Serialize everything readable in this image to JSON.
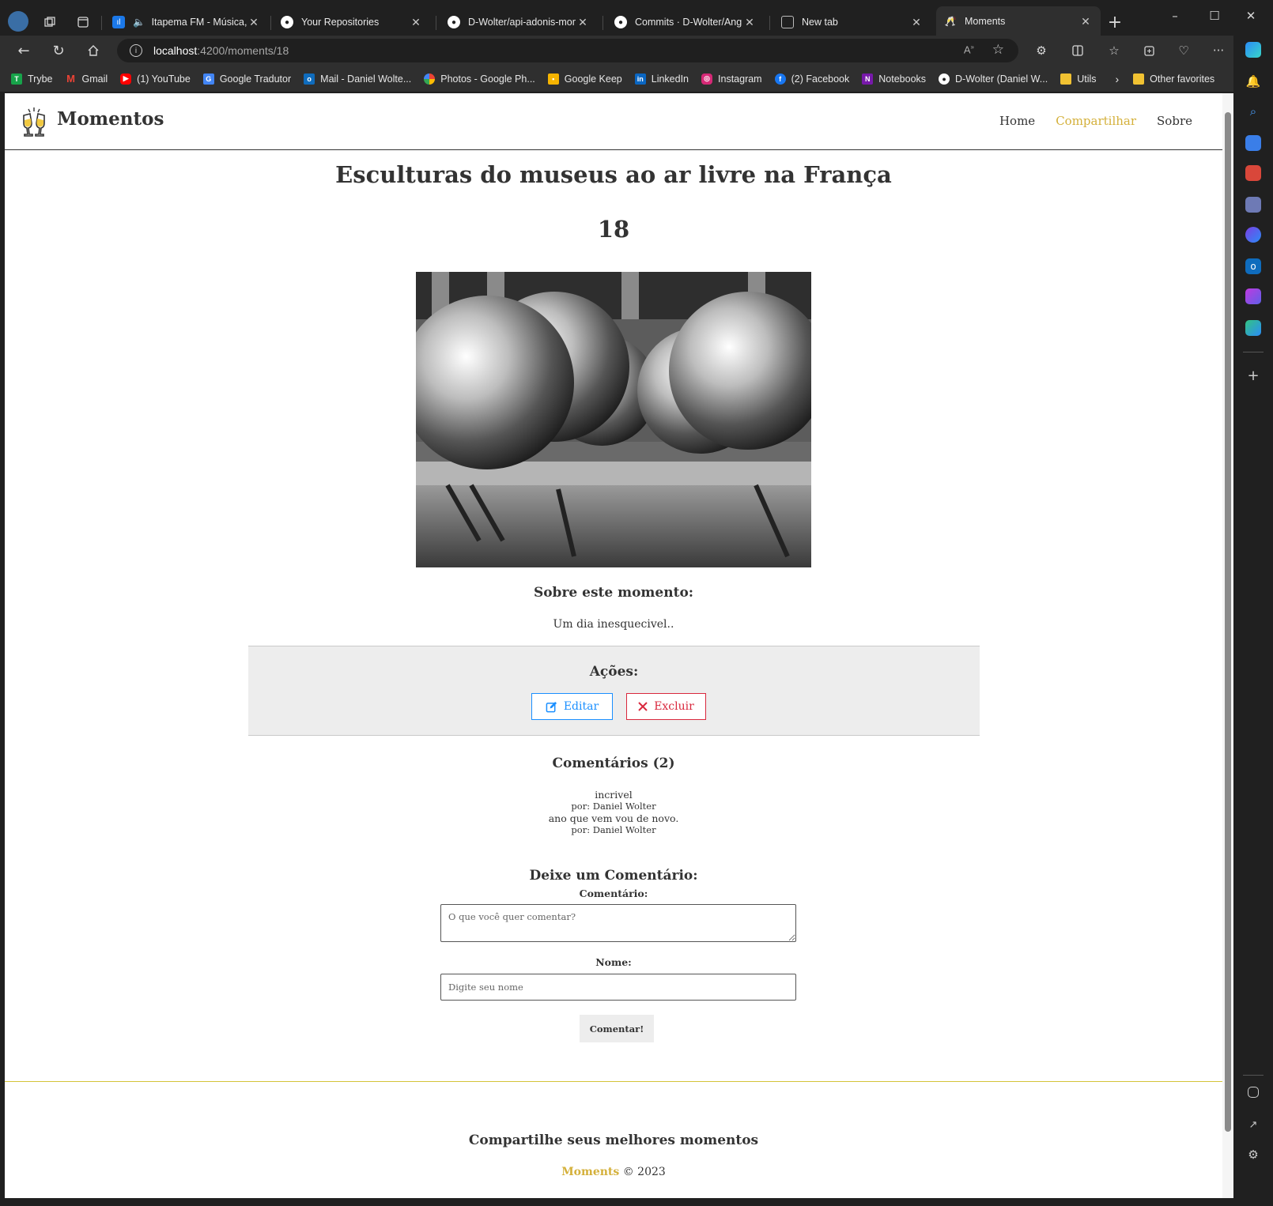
{
  "browser": {
    "tabs": [
      {
        "label": "Itapema FM - Música, ",
        "icon": "radio-icon",
        "color": "#1b78e8"
      },
      {
        "label": "Your Repositories",
        "icon": "github-icon",
        "color": "#ffffff"
      },
      {
        "label": "D-Wolter/api-adonis-mome",
        "icon": "github-icon",
        "color": "#ffffff"
      },
      {
        "label": "Commits · D-Wolter/Angul",
        "icon": "github-icon",
        "color": "#ffffff"
      },
      {
        "label": "New tab",
        "icon": "newtab-icon",
        "color": "#aaaaaa"
      },
      {
        "label": "Moments",
        "icon": "cheers-icon",
        "color": "#e0b84a"
      }
    ],
    "address": {
      "host": "localhost",
      "path": ":4200/moments/18"
    },
    "bookmarks": [
      {
        "label": "Trybe",
        "icon": "trybe-icon",
        "color": "#17a34a"
      },
      {
        "label": "Gmail",
        "icon": "gmail-icon",
        "color": "#ea4335"
      },
      {
        "label": "(1) YouTube",
        "icon": "youtube-icon",
        "color": "#ff0000"
      },
      {
        "label": "Google Tradutor",
        "icon": "translate-icon",
        "color": "#4285f4"
      },
      {
        "label": "Mail - Daniel Wolte...",
        "icon": "outlook-icon",
        "color": "#0f6cbd"
      },
      {
        "label": "Photos - Google Ph...",
        "icon": "photos-icon",
        "color": "#fbbc04"
      },
      {
        "label": "Google Keep",
        "icon": "keep-icon",
        "color": "#f6b400"
      },
      {
        "label": "LinkedIn",
        "icon": "linkedin-icon",
        "color": "#0a66c2"
      },
      {
        "label": "Instagram",
        "icon": "instagram-icon",
        "color": "#d62976"
      },
      {
        "label": "(2) Facebook",
        "icon": "facebook-icon",
        "color": "#1877f2"
      },
      {
        "label": "Notebooks",
        "icon": "onenote-icon",
        "color": "#7719aa"
      },
      {
        "label": "D-Wolter (Daniel W...",
        "icon": "github-icon",
        "color": "#ffffff"
      },
      {
        "label": "Utils",
        "icon": "folder-icon",
        "color": "#f1c232"
      }
    ],
    "other_favorites": "Other favorites"
  },
  "site": {
    "brand": "Momentos",
    "nav": {
      "home": "Home",
      "share": "Compartilhar",
      "about": "Sobre"
    },
    "accent_color": "#d4b03a"
  },
  "moment": {
    "title": "Esculturas do museus ao ar livre na França",
    "id": "18",
    "image_alt": "Esculturas do museus ao ar livre na França",
    "about_heading": "Sobre este momento:",
    "about_text": "Um dia inesquecivel.."
  },
  "actions": {
    "heading": "Ações:",
    "edit": "Editar",
    "delete": "Excluir"
  },
  "comments": {
    "heading": "Comentários (2)",
    "items": [
      {
        "text": "incrivel",
        "author": "por: Daniel Wolter"
      },
      {
        "text": "ano que vem vou de novo.",
        "author": "por: Daniel Wolter"
      }
    ]
  },
  "comment_form": {
    "heading": "Deixe um Comentário:",
    "comment_label": "Comentário:",
    "comment_placeholder": "O que você quer comentar?",
    "name_label": "Nome:",
    "name_placeholder": "Digite seu nome",
    "submit": "Comentar!"
  },
  "footer": {
    "tagline": "Compartilhe seus melhores momentos",
    "brand": "Moments",
    "copyright": " © 2023"
  }
}
